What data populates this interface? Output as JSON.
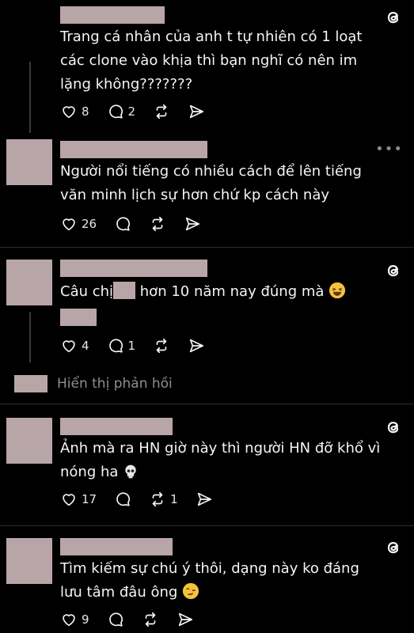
{
  "posts": [
    {
      "text": "Trang cá nhân của anh t tự nhiên có 1 loạt các clone vào khịa thì bạn nghĩ có nên im lặng không???????",
      "likes": "8",
      "replies": "2",
      "reposts": ""
    },
    {
      "text": "Người nổi tiếng có nhiều cách để lên tiếng văn minh lịch sự hơn chứ kp cách này",
      "likes": "26",
      "replies": "",
      "reposts": "",
      "more": "•••"
    },
    {
      "text_before": "Câu chị",
      "text_after": " hơn 10 năm nay đúng mà",
      "likes": "4",
      "replies": "1",
      "reposts": ""
    },
    {
      "text": "Ảnh mà ra HN giờ này thì người HN đỡ khổ vì nóng ha",
      "likes": "17",
      "replies": "",
      "reposts": "1"
    },
    {
      "text": "Tìm kiếm sự chú ý thôi, dạng này ko đáng lưu tâm đâu ông",
      "likes": "9",
      "replies": "",
      "reposts": ""
    }
  ],
  "show_replies_label": "Hiển thị phản hồi",
  "icons": [
    "threads-logo-icon",
    "heart-icon",
    "comment-icon",
    "repost-icon",
    "share-icon",
    "more-icon"
  ],
  "colors": {
    "background": "#000000",
    "text": "#f3f5f7",
    "redaction": "#b8a5a8"
  }
}
